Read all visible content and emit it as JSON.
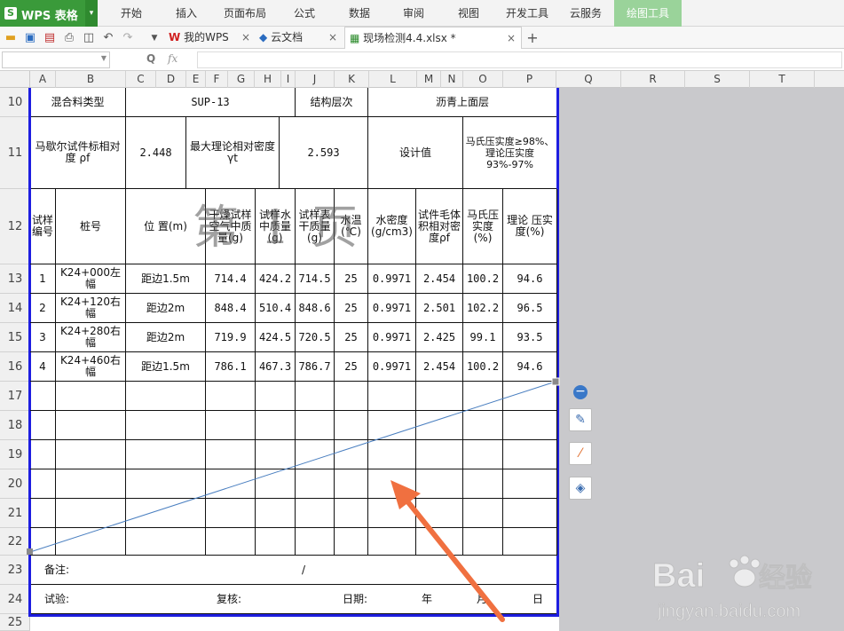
{
  "app": {
    "logo": "WPS 表格",
    "logo_glyph": "S"
  },
  "menu": [
    "开始",
    "插入",
    "页面布局",
    "公式",
    "数据",
    "审阅",
    "视图",
    "开发工具",
    "云服务",
    "绘图工具"
  ],
  "tabs": [
    {
      "label": "我的WPS",
      "icon": "wps-icon"
    },
    {
      "label": "云文档",
      "icon": "cloud-cube-icon"
    },
    {
      "label": "现场检测4.4.xlsx *",
      "icon": "sheet-file-icon"
    }
  ],
  "formula": {
    "fx": "fx",
    "zoom": "Q"
  },
  "columns": [
    "A",
    "B",
    "C",
    "D",
    "E",
    "F",
    "G",
    "H",
    "I",
    "J",
    "K",
    "L",
    "M",
    "N",
    "O",
    "P",
    "Q",
    "R",
    "S",
    "T"
  ],
  "rows": [
    "10",
    "11",
    "12",
    "13",
    "14",
    "15",
    "16",
    "17",
    "18",
    "19",
    "20",
    "21",
    "22",
    "23",
    "24",
    "25"
  ],
  "sheet": {
    "r10": {
      "a": "混合料类型",
      "b": "SUP-13",
      "c": "结构层次",
      "d": "沥青上面层"
    },
    "r11": {
      "a": "马歇尔试件标相对度 ρf",
      "b": "2.448",
      "c": "最大理论相对密度 γt",
      "d": "2.593",
      "e": "设计值",
      "f": "马氏压实度≥98%、理论压实度93%-97%"
    },
    "headers": [
      "试样编号",
      "桩号",
      "位 置(m)",
      "干燥试样空气中质量(g)",
      "试样水中质量(g)",
      "试样表干质量(g)",
      "水温(℃)",
      "水密度(g/cm3)",
      "试件毛体积相对密度ρf",
      "马氏压实度(%)",
      "理论 压实度(%)"
    ],
    "data": [
      [
        "1",
        "K24+000左幅",
        "距边1.5m",
        "714.4",
        "424.2",
        "714.5",
        "25",
        "0.9971",
        "2.454",
        "100.2",
        "94.6"
      ],
      [
        "2",
        "K24+120右幅",
        "距边2m",
        "848.4",
        "510.4",
        "848.6",
        "25",
        "0.9971",
        "2.501",
        "102.2",
        "96.5"
      ],
      [
        "3",
        "K24+280右幅",
        "距边2m",
        "719.9",
        "424.5",
        "720.5",
        "25",
        "0.9971",
        "2.425",
        "99.1",
        "93.5"
      ],
      [
        "4",
        "K24+460右幅",
        "距边1.5m",
        "786.1",
        "467.3",
        "786.7",
        "25",
        "0.9971",
        "2.454",
        "100.2",
        "94.6"
      ]
    ],
    "remark_label": "备注:",
    "remark_slash": "/",
    "sig": {
      "test": "试验:",
      "review": "复核:",
      "date": "日期:",
      "year": "年",
      "month": "月",
      "day": "日"
    }
  },
  "watermark": "第 1 页",
  "side_tools": [
    "minus-icon",
    "pen-edit-icon",
    "line-style-icon",
    "layers-icon"
  ],
  "colors": {
    "brand": "#3a9a3a",
    "print_border": "#1e1ee0",
    "line": "#4a7fc0",
    "arrow": "#f07040"
  }
}
